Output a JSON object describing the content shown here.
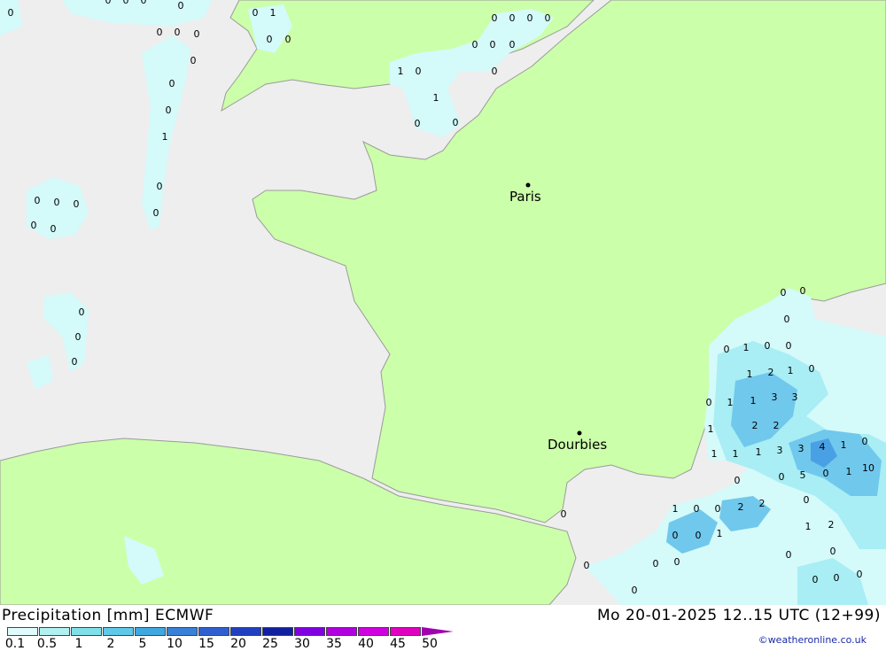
{
  "header": {
    "title_left": "Precipitation [mm] ECMWF",
    "title_right": "Mo 20-01-2025 12..15 UTC (12+99)",
    "credit": "©weatheronline.co.uk"
  },
  "legend": {
    "labels": [
      "0.1",
      "0.5",
      "1",
      "2",
      "5",
      "10",
      "15",
      "20",
      "25",
      "30",
      "35",
      "40",
      "45",
      "50"
    ],
    "colors": [
      "#e0fbfb",
      "#b0f0f0",
      "#80e0e8",
      "#60c8e8",
      "#40a8e0",
      "#3880d8",
      "#3060d0",
      "#2040c0",
      "#1020a0",
      "#8000e0",
      "#b000e0",
      "#d000e0",
      "#e000c0",
      "#a000b0"
    ]
  },
  "map": {
    "cities": [
      {
        "name": "Paris"
      },
      {
        "name": "Dourbies"
      }
    ],
    "colors": {
      "sea": "#eeeeee",
      "land": "#ccffaa",
      "light_precip": "#d4fafa",
      "med_precip": "#a8eef4",
      "heavy_precip": "#70c8ec",
      "heavier_precip": "#4aa0e4"
    },
    "values": [
      "0",
      "0",
      "0",
      "0",
      "1",
      "0",
      "0",
      "0",
      "0",
      "0",
      "0",
      "0",
      "0",
      "0",
      "0",
      "0",
      "1",
      "0",
      "0",
      "1",
      "0",
      "0",
      "0",
      "0",
      "0",
      "0",
      "0",
      "0",
      "1",
      "0",
      "0",
      "0",
      "0",
      "0",
      "0",
      "0",
      "0",
      "0",
      "0",
      "0",
      "0",
      "0",
      "0",
      "1",
      "2",
      "1",
      "0",
      "0",
      "1",
      "3",
      "3",
      "1",
      "0",
      "2",
      "2",
      "1",
      "1",
      "1",
      "1",
      "3",
      "3",
      "4",
      "1",
      "0",
      "5",
      "0",
      "1",
      "10",
      "0",
      "0",
      "0",
      "1",
      "2",
      "2",
      "0",
      "0",
      "1",
      "2",
      "0",
      "1",
      "0",
      "0",
      "1",
      "0",
      "0",
      "0",
      "0",
      "0",
      "0",
      "0",
      "0",
      "0",
      "0"
    ]
  }
}
